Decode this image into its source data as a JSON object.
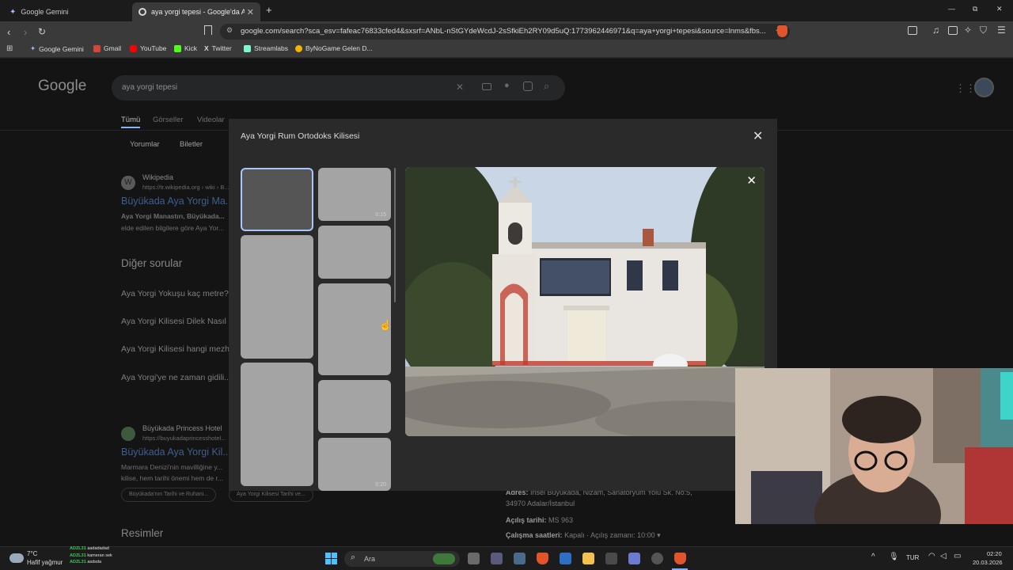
{
  "tabs": [
    {
      "title": "Google Gemini",
      "active": false
    },
    {
      "title": "aya yorgi tepesi - Google'da Ara",
      "active": true
    }
  ],
  "new_tab_label": "+",
  "window_controls": {
    "minimize": "—",
    "restore": "⧉",
    "close": "✕"
  },
  "address_bar": {
    "url": "google.com/search?sca_esv=fafeac76833cfed4&sxsrf=ANbL-nStGYdeWcdJ-2sSfkiEh2RY09d5uQ:1773962446971&q=aya+yorgi+tepesi&source=lnms&fbs..."
  },
  "bookmarks": [
    {
      "label": "Google Gemini",
      "icon": "gemini-icon"
    },
    {
      "label": "Gmail",
      "icon": "gmail-icon"
    },
    {
      "label": "YouTube",
      "icon": "youtube-icon"
    },
    {
      "label": "Kick",
      "icon": "kick-icon"
    },
    {
      "label": "Twitter",
      "icon": "x-icon"
    },
    {
      "label": "Streamlabs",
      "icon": "streamlabs-icon"
    },
    {
      "label": "ByNoGame Gelen D...",
      "icon": "bynogame-icon"
    }
  ],
  "google": {
    "logo": "Google",
    "query": "aya yorgi tepesi",
    "tabs": [
      "Tümü",
      "Görseller",
      "Videolar"
    ],
    "filters": [
      "Yorumlar",
      "Biletler"
    ],
    "results": [
      {
        "source": "Wikipedia",
        "url": "https://tr.wikipedia.org › wiki › B...",
        "title": "Büyükada Aya Yorgi Ma...",
        "snippet1": "Aya Yorgi Manastırı, Büyükada...",
        "snippet2": "elde edilen bilgilere göre Aya Yor..."
      },
      {
        "source": "Büyükada Princess Hotel",
        "url": "https://buyukadaprincesshotel...",
        "title": "Büyükada Aya Yorgi Kil...",
        "snippet1": "Marmara Denizi'nin mavilliğine y...",
        "snippet2": "kilise, hem tarihi önemi hem de r..."
      }
    ],
    "other_questions_title": "Diğer sorular",
    "questions": [
      "Aya Yorgi Yokuşu kaç metre?",
      "Aya Yorgi Kilisesi Dilek Nasıl ...",
      "Aya Yorgi Kilisesi hangi mezh...",
      "Aya Yorgi'ye ne zaman gidili..."
    ],
    "chips": [
      "Büyükada'nın Tarihi ve Ruhani...",
      "Aya Yorgi Kilisesi Tarihi ve..."
    ],
    "images_title": "Resimler"
  },
  "modal": {
    "title": "Aya Yorgi Rum Ortodoks Kilisesi",
    "thumb_durations": [
      "0:15",
      "0:20"
    ]
  },
  "place_info": {
    "address_label": "Adres:",
    "address_value": "İnsel Büyükada, Nizam, Sanatoryum Yolu Sk. No:5,",
    "address_line2": "34970 Adalar/İstanbul",
    "founded_label": "Açılış tarihi:",
    "founded_value": "MS 963",
    "hours_label": "Çalışma saatleri:",
    "hours_value": "Kapalı · Açılış zamanı: 10:00 ▾"
  },
  "taskbar": {
    "weather_temp": "7°C",
    "weather_desc": "Hafif yağmur",
    "ticker": [
      {
        "tag": "ADZL31",
        "text": "aadadadad"
      },
      {
        "tag": "ADZL31",
        "text": "kameran sek"
      },
      {
        "tag": "ADZL31",
        "text": "asdsda"
      }
    ],
    "search_placeholder": "Ara",
    "language": "TUR",
    "time": "02:20",
    "date": "20.03.2026"
  }
}
